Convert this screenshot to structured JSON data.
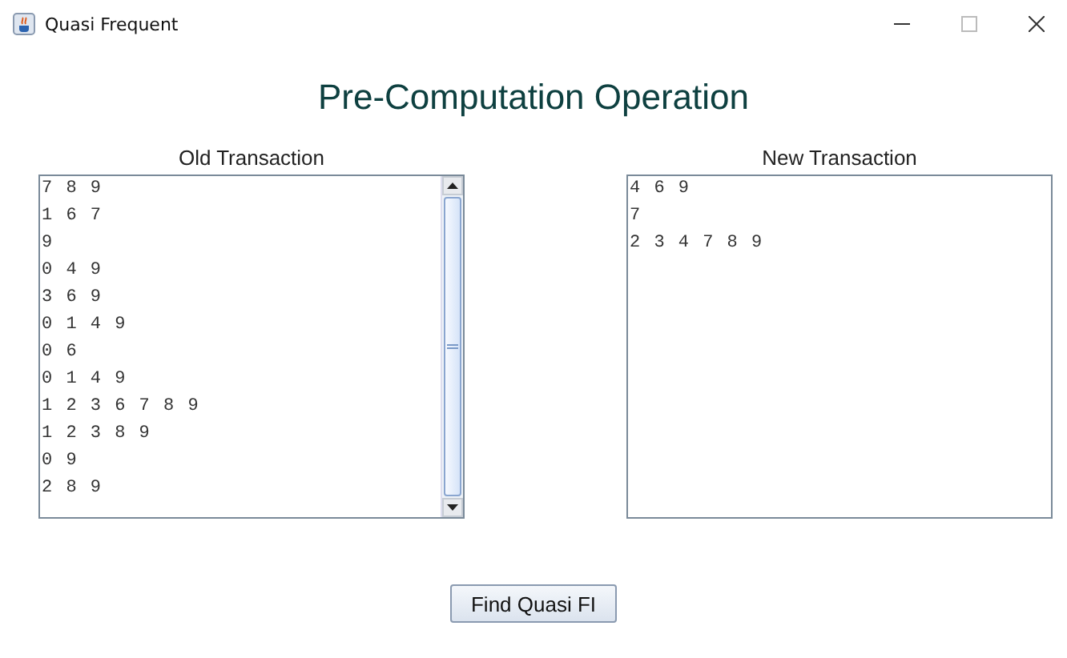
{
  "window": {
    "title": "Quasi Frequent"
  },
  "heading": "Pre-Computation Operation",
  "old_transaction": {
    "label": "Old Transaction",
    "lines": [
      "7 8 9",
      "1 6 7",
      "9",
      "0 4 9",
      "3 6 9",
      "0 1 4 9",
      "0 6",
      "0 1 4 9",
      "1 2 3 6 7 8 9",
      "1 2 3 8 9",
      "0 9",
      "2 8 9"
    ]
  },
  "new_transaction": {
    "label": "New Transaction",
    "lines": [
      "4 6 9",
      "7",
      "2 3 4 7 8 9"
    ]
  },
  "button": "Find Quasi FI"
}
